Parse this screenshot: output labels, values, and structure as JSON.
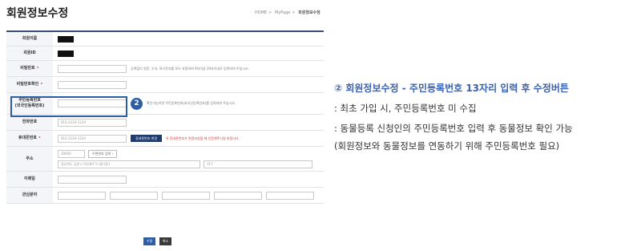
{
  "page": {
    "title": "회원정보수정",
    "breadcrumb": [
      "HOME",
      "MyPage",
      "회원정보수정"
    ]
  },
  "form": {
    "rows": [
      {
        "label": "회원이름",
        "required": false
      },
      {
        "label": "회원ID",
        "required": false
      },
      {
        "label": "비밀번호",
        "required": true,
        "hint": "공백없이 영문, 숫자, 특수문자를 모두 포함하여 9자이상 20자이내로 입력하여 주십시오."
      },
      {
        "label": "비밀번호확인",
        "required": true
      },
      {
        "label": "주민등록번호",
        "label2": "(외국인등록번호)",
        "required": false,
        "badge": "2",
        "hint": "확인가능하면 주민등록번호(외국인등록번호)를 입력하여 주십시오."
      },
      {
        "label": "전화번호",
        "required": false,
        "value": "010-1234-1234"
      },
      {
        "label": "휴대폰번호",
        "required": true,
        "value": "010-1234-1234",
        "button": "휴대폰번호 변경",
        "hint": "※ 휴대폰번호가 변경되었을 때 인증해주시길 바랍니다."
      },
      {
        "label": "주소",
        "required": false,
        "zip": "39660",
        "zip_button": "우편번호 검색",
        "address": "경상북도 김천시 혁신8로 5 (율곡동)",
        "address_detail": "117"
      },
      {
        "label": "이메일",
        "required": false
      },
      {
        "label": "관심분야",
        "required": false
      }
    ],
    "submit_label": "수정",
    "cancel_label": "취소",
    "required_mark": "•"
  },
  "annotation": {
    "title": "② 회원정보수정 - 주민등록번호 13자리 입력 후 수정버튼",
    "lines": [
      ": 최초 가입 시, 주민등록번호 미 수집",
      ": 동물등록 신청인의 주민등록번호 입력 후 동물정보 확인 가능",
      " (회원정보와 동물정보를 연동하기 위해 주민등록번호 필요)"
    ]
  },
  "colors": {
    "accent": "#2c5ea8",
    "header_border": "#3c4f74",
    "annotation_title": "#3a62b0",
    "required": "#e05a2b"
  }
}
